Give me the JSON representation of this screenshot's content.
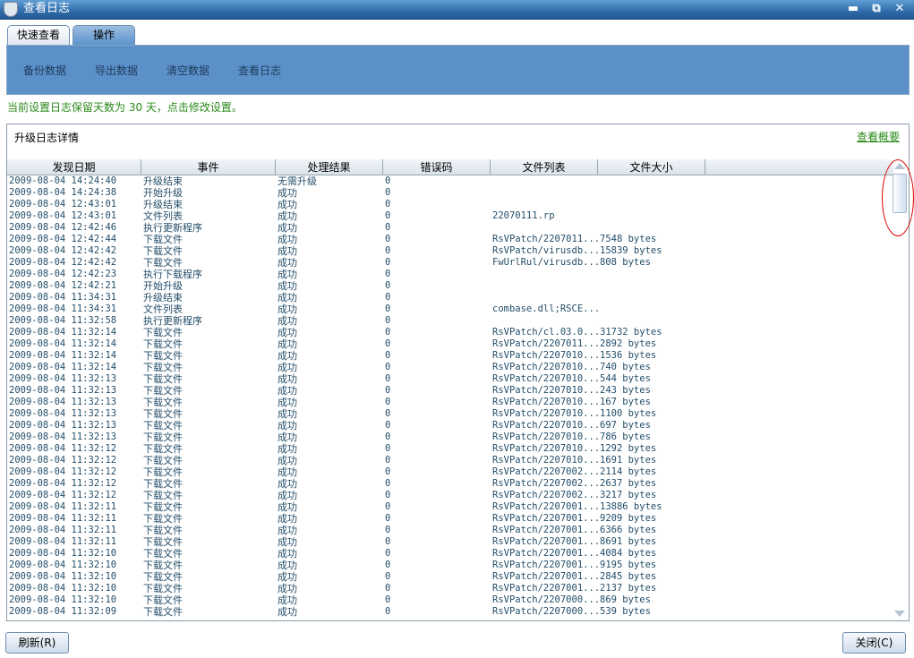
{
  "window": {
    "title": "查看日志",
    "min": "▬",
    "restore": "⧉",
    "close": "✕"
  },
  "tabs": [
    "快速查看",
    "操作"
  ],
  "ops": [
    "备份数据",
    "导出数据",
    "清空数据",
    "查看日志"
  ],
  "note": "当前设置日志保留天数为 30 天，点击修改设置。",
  "panel": {
    "title": "升级日志详情",
    "link": "查看概要"
  },
  "columns": [
    "发现日期",
    "事件",
    "处理结果",
    "错误码",
    "文件列表",
    "文件大小"
  ],
  "rows": [
    [
      "2009-08-04 14:24:40",
      "升级结束",
      "无需升级",
      "0",
      "",
      ""
    ],
    [
      "2009-08-04 14:24:38",
      "开始升级",
      "成功",
      "0",
      "",
      ""
    ],
    [
      "2009-08-04 12:43:01",
      "升级结束",
      "成功",
      "0",
      "",
      ""
    ],
    [
      "2009-08-04 12:43:01",
      "文件列表",
      "成功",
      "0",
      "22070111.rp",
      ""
    ],
    [
      "2009-08-04 12:42:46",
      "执行更新程序",
      "成功",
      "0",
      "",
      ""
    ],
    [
      "2009-08-04 12:42:44",
      "下载文件",
      "成功",
      "0",
      "RsVPatch/2207011...",
      "7548 bytes"
    ],
    [
      "2009-08-04 12:42:42",
      "下载文件",
      "成功",
      "0",
      "RsVPatch/virusdb...",
      "15839 bytes"
    ],
    [
      "2009-08-04 12:42:42",
      "下载文件",
      "成功",
      "0",
      "FwUrlRul/virusdb...",
      "808 bytes"
    ],
    [
      "2009-08-04 12:42:23",
      "执行下载程序",
      "成功",
      "0",
      "",
      ""
    ],
    [
      "2009-08-04 12:42:21",
      "开始升级",
      "成功",
      "0",
      "",
      ""
    ],
    [
      "2009-08-04 11:34:31",
      "升级结束",
      "成功",
      "0",
      "",
      ""
    ],
    [
      "2009-08-04 11:34:31",
      "文件列表",
      "成功",
      "0",
      "combase.dll;RSCE...",
      ""
    ],
    [
      "2009-08-04 11:32:58",
      "执行更新程序",
      "成功",
      "0",
      "",
      ""
    ],
    [
      "2009-08-04 11:32:14",
      "下载文件",
      "成功",
      "0",
      "RsVPatch/cl.03.0...",
      "31732 bytes"
    ],
    [
      "2009-08-04 11:32:14",
      "下载文件",
      "成功",
      "0",
      "RsVPatch/2207011...",
      "2892 bytes"
    ],
    [
      "2009-08-04 11:32:14",
      "下载文件",
      "成功",
      "0",
      "RsVPatch/2207010...",
      "1536 bytes"
    ],
    [
      "2009-08-04 11:32:14",
      "下载文件",
      "成功",
      "0",
      "RsVPatch/2207010...",
      "740 bytes"
    ],
    [
      "2009-08-04 11:32:13",
      "下载文件",
      "成功",
      "0",
      "RsVPatch/2207010...",
      "544 bytes"
    ],
    [
      "2009-08-04 11:32:13",
      "下载文件",
      "成功",
      "0",
      "RsVPatch/2207010...",
      "243 bytes"
    ],
    [
      "2009-08-04 11:32:13",
      "下载文件",
      "成功",
      "0",
      "RsVPatch/2207010...",
      "167 bytes"
    ],
    [
      "2009-08-04 11:32:13",
      "下载文件",
      "成功",
      "0",
      "RsVPatch/2207010...",
      "1100 bytes"
    ],
    [
      "2009-08-04 11:32:13",
      "下载文件",
      "成功",
      "0",
      "RsVPatch/2207010...",
      "697 bytes"
    ],
    [
      "2009-08-04 11:32:13",
      "下载文件",
      "成功",
      "0",
      "RsVPatch/2207010...",
      "786 bytes"
    ],
    [
      "2009-08-04 11:32:12",
      "下载文件",
      "成功",
      "0",
      "RsVPatch/2207010...",
      "1292 bytes"
    ],
    [
      "2009-08-04 11:32:12",
      "下载文件",
      "成功",
      "0",
      "RsVPatch/2207010...",
      "1691 bytes"
    ],
    [
      "2009-08-04 11:32:12",
      "下载文件",
      "成功",
      "0",
      "RsVPatch/2207002...",
      "2114 bytes"
    ],
    [
      "2009-08-04 11:32:12",
      "下载文件",
      "成功",
      "0",
      "RsVPatch/2207002...",
      "2637 bytes"
    ],
    [
      "2009-08-04 11:32:12",
      "下载文件",
      "成功",
      "0",
      "RsVPatch/2207002...",
      "3217 bytes"
    ],
    [
      "2009-08-04 11:32:11",
      "下载文件",
      "成功",
      "0",
      "RsVPatch/2207001...",
      "13886 bytes"
    ],
    [
      "2009-08-04 11:32:11",
      "下载文件",
      "成功",
      "0",
      "RsVPatch/2207001...",
      "9209 bytes"
    ],
    [
      "2009-08-04 11:32:11",
      "下载文件",
      "成功",
      "0",
      "RsVPatch/2207001...",
      "6366 bytes"
    ],
    [
      "2009-08-04 11:32:11",
      "下载文件",
      "成功",
      "0",
      "RsVPatch/2207001...",
      "8691 bytes"
    ],
    [
      "2009-08-04 11:32:10",
      "下载文件",
      "成功",
      "0",
      "RsVPatch/2207001...",
      "4084 bytes"
    ],
    [
      "2009-08-04 11:32:10",
      "下载文件",
      "成功",
      "0",
      "RsVPatch/2207001...",
      "9195 bytes"
    ],
    [
      "2009-08-04 11:32:10",
      "下载文件",
      "成功",
      "0",
      "RsVPatch/2207001...",
      "2845 bytes"
    ],
    [
      "2009-08-04 11:32:10",
      "下载文件",
      "成功",
      "0",
      "RsVPatch/2207001...",
      "2137 bytes"
    ],
    [
      "2009-08-04 11:32:10",
      "下载文件",
      "成功",
      "0",
      "RsVPatch/2207000...",
      "869 bytes"
    ],
    [
      "2009-08-04 11:32:09",
      "下载文件",
      "成功",
      "0",
      "RsVPatch/2207000...",
      "539 bytes"
    ]
  ],
  "buttons": {
    "refresh": "刷新(R)",
    "close": "关闭(C)"
  }
}
